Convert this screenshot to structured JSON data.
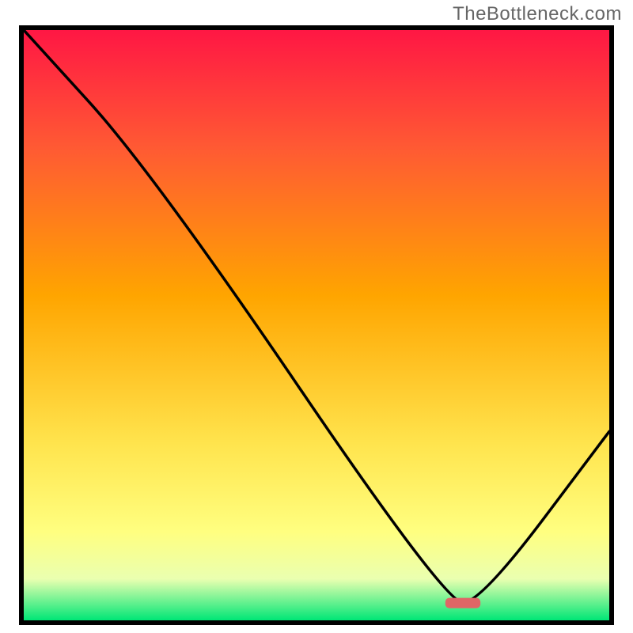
{
  "watermark": "TheBottleneck.com",
  "chart_data": {
    "type": "line",
    "title": "",
    "xlabel": "",
    "ylabel": "",
    "xlim": [
      0,
      100
    ],
    "ylim": [
      0,
      100
    ],
    "x": [
      0,
      22,
      72,
      78,
      100
    ],
    "values": [
      100,
      76,
      3,
      3,
      32
    ],
    "marker": {
      "x_range": [
        72,
        78
      ],
      "y": 3,
      "color": "#e06666"
    },
    "background_gradient": {
      "stops": [
        {
          "offset": 0.0,
          "color": "#ff1744"
        },
        {
          "offset": 0.2,
          "color": "#ff5a33"
        },
        {
          "offset": 0.45,
          "color": "#ffa500"
        },
        {
          "offset": 0.7,
          "color": "#ffe44d"
        },
        {
          "offset": 0.85,
          "color": "#ffff80"
        },
        {
          "offset": 0.93,
          "color": "#eaffb0"
        },
        {
          "offset": 1.0,
          "color": "#00e676"
        }
      ]
    }
  }
}
